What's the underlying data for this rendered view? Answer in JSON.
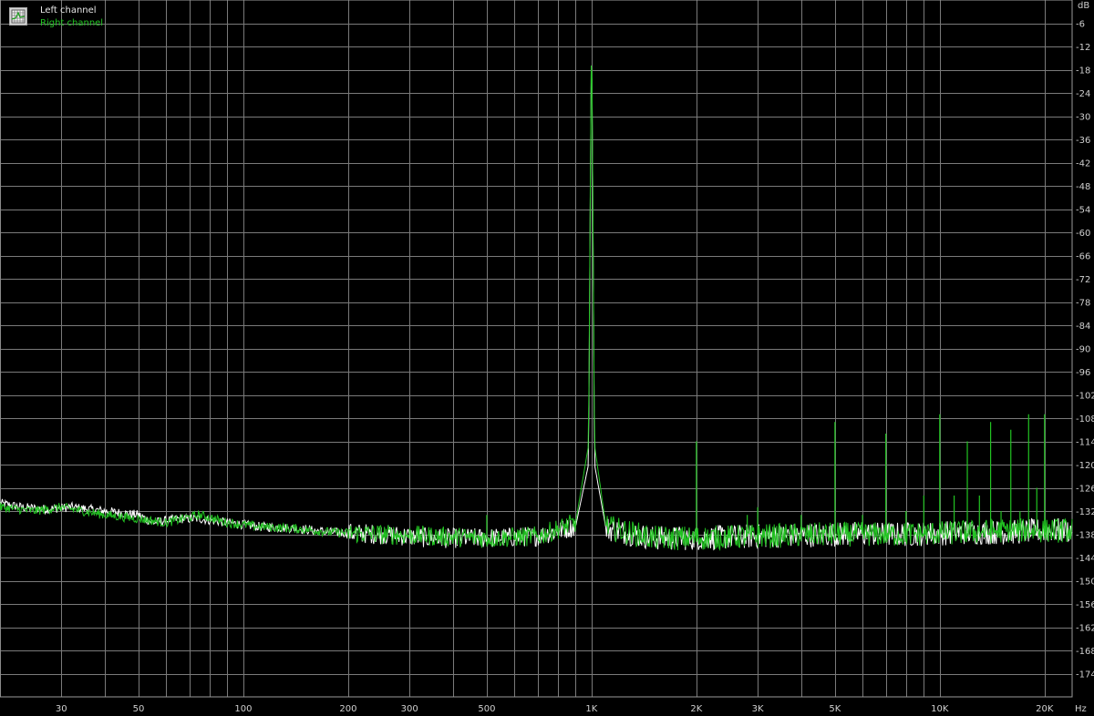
{
  "chart_data": {
    "type": "line",
    "x_scale": "log",
    "xlim": [
      20,
      24000
    ],
    "ylim": [
      -180,
      0
    ],
    "y_unit": "dB",
    "x_unit": "Hz",
    "y_ticks": [
      -6,
      -12,
      -18,
      -24,
      -30,
      -36,
      -42,
      -48,
      -54,
      -60,
      -66,
      -72,
      -78,
      -84,
      -90,
      -96,
      -102,
      -108,
      -114,
      -120,
      -126,
      -132,
      -138,
      -144,
      -150,
      -156,
      -162,
      -168,
      -174
    ],
    "x_ticks": [
      {
        "value": 30,
        "label": "30"
      },
      {
        "value": 50,
        "label": "50"
      },
      {
        "value": 100,
        "label": "100"
      },
      {
        "value": 200,
        "label": "200"
      },
      {
        "value": 300,
        "label": "300"
      },
      {
        "value": 500,
        "label": "500"
      },
      {
        "value": 1000,
        "label": "1K"
      },
      {
        "value": 2000,
        "label": "2K"
      },
      {
        "value": 3000,
        "label": "3K"
      },
      {
        "value": 5000,
        "label": "5K"
      },
      {
        "value": 10000,
        "label": "10K"
      },
      {
        "value": 20000,
        "label": "20K"
      }
    ],
    "grid": true,
    "legend_position": "top-left",
    "series": [
      {
        "name": "Left channel",
        "color": "#ffffff",
        "points": [
          [
            20,
            -130
          ],
          [
            23,
            -131
          ],
          [
            27,
            -131.5
          ],
          [
            32,
            -131
          ],
          [
            40,
            -132
          ],
          [
            50,
            -133
          ],
          [
            55,
            -135
          ],
          [
            65,
            -134
          ],
          [
            75,
            -134
          ],
          [
            90,
            -135
          ],
          [
            110,
            -136
          ],
          [
            140,
            -136.5
          ],
          [
            180,
            -137.5
          ],
          [
            250,
            -138
          ],
          [
            350,
            -139
          ],
          [
            500,
            -139
          ],
          [
            700,
            -138.5
          ],
          [
            900,
            -136
          ],
          [
            980,
            -120
          ],
          [
            1000,
            -5
          ],
          [
            1020,
            -120
          ],
          [
            1100,
            -136.5
          ],
          [
            1500,
            -139
          ],
          [
            2000,
            -139
          ],
          [
            3000,
            -138.5
          ],
          [
            5000,
            -138
          ],
          [
            8000,
            -138
          ],
          [
            12000,
            -137.5
          ],
          [
            16000,
            -137.5
          ],
          [
            20000,
            -137
          ],
          [
            24000,
            -137
          ]
        ]
      },
      {
        "name": "Right channel",
        "color": "#22c322",
        "points": [
          [
            20,
            -131
          ],
          [
            25,
            -132
          ],
          [
            30,
            -131
          ],
          [
            40,
            -133
          ],
          [
            50,
            -134
          ],
          [
            60,
            -135
          ],
          [
            75,
            -133
          ],
          [
            90,
            -135
          ],
          [
            110,
            -136
          ],
          [
            140,
            -136.5
          ],
          [
            180,
            -137.5
          ],
          [
            250,
            -138
          ],
          [
            350,
            -138.5
          ],
          [
            500,
            -139
          ],
          [
            700,
            -138.5
          ],
          [
            900,
            -135
          ],
          [
            980,
            -115
          ],
          [
            1000,
            -4
          ],
          [
            1020,
            -115
          ],
          [
            1100,
            -136
          ],
          [
            1500,
            -139
          ],
          [
            2000,
            -139
          ],
          [
            3000,
            -138.5
          ],
          [
            5000,
            -138
          ],
          [
            8000,
            -138
          ],
          [
            12000,
            -137.5
          ],
          [
            16000,
            -137
          ],
          [
            20000,
            -137
          ],
          [
            24000,
            -137
          ]
        ],
        "spurs": [
          [
            500,
            -133
          ],
          [
            2000,
            -114
          ],
          [
            2800,
            -133
          ],
          [
            3000,
            -131
          ],
          [
            4000,
            -133
          ],
          [
            5000,
            -109
          ],
          [
            6000,
            -133
          ],
          [
            7000,
            -112
          ],
          [
            8000,
            -132
          ],
          [
            9000,
            -128
          ],
          [
            10000,
            -107
          ],
          [
            11000,
            -128
          ],
          [
            12000,
            -114
          ],
          [
            13000,
            -128
          ],
          [
            14000,
            -109
          ],
          [
            15000,
            -132
          ],
          [
            16000,
            -111
          ],
          [
            17000,
            -132
          ],
          [
            18000,
            -107
          ],
          [
            19000,
            -126
          ],
          [
            20000,
            -107
          ]
        ]
      }
    ]
  },
  "legend": {
    "left_label": "Left channel",
    "right_label": "Right channel"
  },
  "axis_labels": {
    "y_unit_label": "dB",
    "x_unit_label": "Hz"
  }
}
